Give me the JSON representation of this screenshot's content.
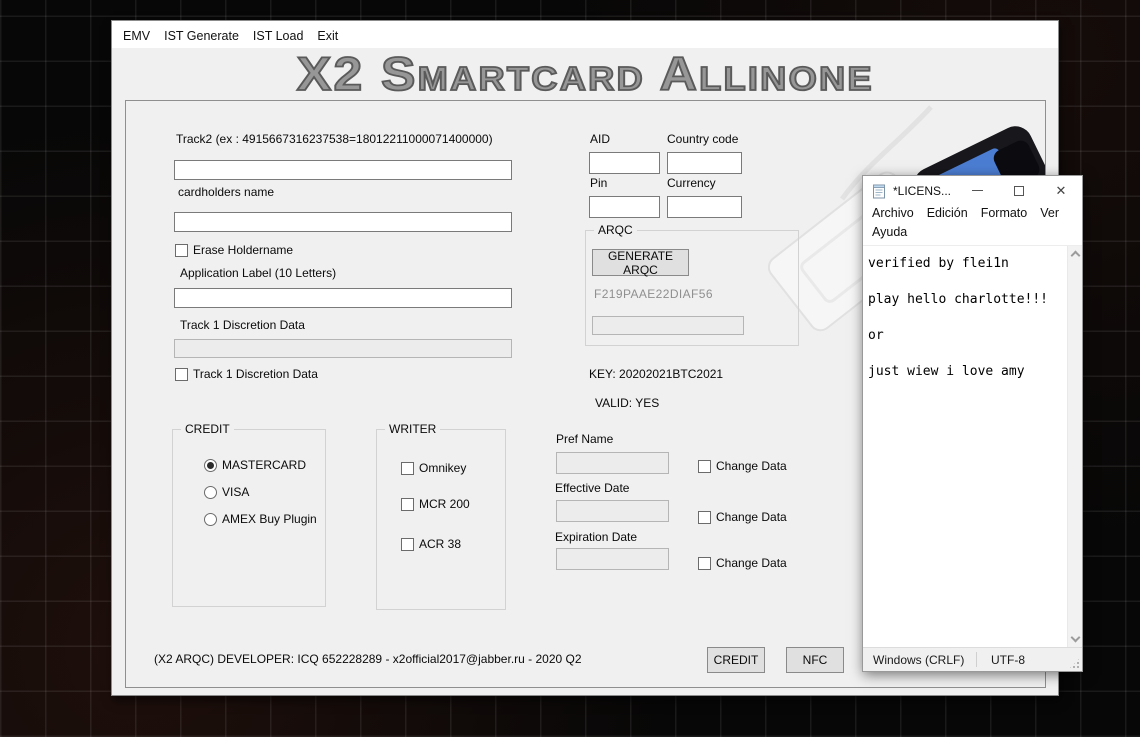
{
  "window": {
    "menu": [
      "EMV",
      "IST Generate",
      "IST Load",
      "Exit"
    ],
    "title": "X2 Smartcard Allinone"
  },
  "form": {
    "track2_label": "Track2 (ex : 4915667316237538=18012211000071400000)",
    "cardholders_label": "cardholders name",
    "erase_holdername_label": "Erase Holdername",
    "application_label": "Application Label (10 Letters)",
    "track1_label": "Track 1 Discretion Data",
    "track1_checkbox_label": "Track 1 Discretion Data",
    "aid_label": "AID",
    "country_code_label": "Country code",
    "pin_label": "Pin",
    "currency_label": "Currency",
    "arqc_group_label": "ARQC",
    "generate_arqc_button": "GENERATE ARQC",
    "arqc_code": "F219PAAE22DIAF56",
    "key_text": "KEY: 20202021BTC2021",
    "valid_text": "VALID: YES",
    "credit_group_label": "CREDIT",
    "credit_options": [
      "MASTERCARD",
      "VISA",
      "AMEX Buy Plugin"
    ],
    "credit_selected": "MASTERCARD",
    "writer_group_label": "WRITER",
    "writer_options": [
      "Omnikey",
      "MCR 200",
      "ACR 38"
    ],
    "pref_name_label": "Pref Name",
    "effective_date_label": "Effective Date",
    "expiration_date_label": "Expiration Date",
    "change_data_label": "Change Data",
    "footer_text": "(X2 ARQC) DEVELOPER: ICQ 652228289 - x2official2017@jabber.ru - 2020 Q2",
    "credit_button": "CREDIT",
    "nfc_button": "NFC"
  },
  "notepad": {
    "title": "*LICENS...",
    "menu": [
      "Archivo",
      "Edición",
      "Formato",
      "Ver",
      "Ayuda"
    ],
    "close_glyph": "✕",
    "lines": [
      "verified by flei1n",
      "",
      "play hello charlotte!!!",
      "",
      "or",
      "",
      "just wiew i love amy"
    ],
    "status_line_ending": "Windows (CRLF)",
    "status_encoding": "UTF-8"
  }
}
